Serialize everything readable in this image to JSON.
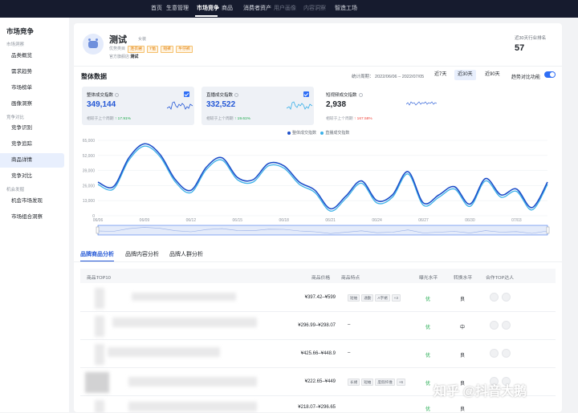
{
  "topnav": {
    "items": [
      "首页",
      "生意管理",
      "市场竞争",
      "商品",
      "消费者资产",
      "用户画像",
      "内容洞察",
      "智造工场"
    ],
    "active_index": 2
  },
  "sidebar": {
    "title": "市场竞争",
    "groups": {
      "market": "市场洞察",
      "compete": "竞争对比",
      "opportunity": "机会发掘"
    },
    "items": {
      "category": "品类概览",
      "demand": "需求趋势",
      "ranking": "市场榜单",
      "portrait": "画像洞察",
      "identify": "竞争识别",
      "track": "竞争追踪",
      "detail": "商品详情",
      "compare": "竞争对比",
      "discover": "机会市场发现",
      "combo": "市场组合洞察"
    },
    "active": "商品详情"
  },
  "shop": {
    "name": "测试",
    "badge": "女装",
    "categories_label": "优势类目",
    "tags": [
      "连衣裙",
      "T恤",
      "短裤",
      "牛仔裤"
    ],
    "official_label": "官方旗舰店",
    "official_value": "测试"
  },
  "rank": {
    "label": "近30天行业排名",
    "value": "57"
  },
  "overview": {
    "title": "整体数据",
    "stat_period_label": "统计周期：",
    "stat_period": "2022/06/06 – 2022/07/05",
    "ranges": [
      "近7天",
      "近30天",
      "近90天"
    ],
    "active_range": "近30天",
    "trend_compare_label": "趋势对比功能",
    "trend_compare_on": true
  },
  "cards": [
    {
      "title": "整体成交指数",
      "value": "349,144",
      "compare_label": "相较于上个周期",
      "change": "↑ 17.91%",
      "direction": "up",
      "checked": true
    },
    {
      "title": "直播成交指数",
      "value": "332,522",
      "compare_label": "相较于上个周期",
      "change": "↑ 19.61%",
      "direction": "up",
      "checked": true
    },
    {
      "title": "短视频成交指数",
      "value": "2,938",
      "compare_label": "相较于上个周期",
      "change": "↑ 167.58%",
      "direction": "down",
      "checked": false
    }
  ],
  "colors": {
    "accent": "#2357d6",
    "series_overall": "#1e4fc9",
    "series_live": "#3ab0e8",
    "up": "#1ba84a",
    "down": "#f0443b"
  },
  "chart_data": {
    "type": "line",
    "x": [
      "06/06",
      "06/07",
      "06/08",
      "06/09",
      "06/10",
      "06/11",
      "06/12",
      "06/13",
      "06/14",
      "06/15",
      "06/16",
      "06/17",
      "06/18",
      "06/19",
      "06/20",
      "06/21",
      "06/22",
      "06/23",
      "06/24",
      "06/25",
      "06/26",
      "06/27",
      "06/28",
      "06/29",
      "06/30",
      "07/01",
      "07/02",
      "07/03",
      "07/04",
      "07/05"
    ],
    "tick_labels": [
      "06/06",
      "06/09",
      "06/12",
      "06/15",
      "06/18",
      "06/21",
      "06/24",
      "06/27",
      "06/30",
      "07/03"
    ],
    "series": [
      {
        "name": "整体成交指数",
        "values": [
          29000,
          25000,
          50000,
          62000,
          53000,
          31000,
          22000,
          42000,
          50000,
          33000,
          31000,
          45000,
          43000,
          29000,
          22000,
          6000,
          17000,
          30000,
          13000,
          18000,
          38000,
          11000,
          18000,
          25000,
          10000,
          32000,
          18000,
          23000,
          7000,
          29000
        ]
      },
      {
        "name": "直播成交指数",
        "values": [
          27000,
          23000,
          48000,
          60000,
          51000,
          29000,
          20000,
          40000,
          48000,
          31000,
          29000,
          43000,
          41000,
          27000,
          20000,
          4000,
          15000,
          28000,
          11000,
          16000,
          36000,
          9000,
          16000,
          23000,
          8000,
          30000,
          16000,
          21000,
          5000,
          27000
        ]
      }
    ],
    "ylim": [
      0,
      65000
    ],
    "yticks": [
      "65,000",
      "52,000",
      "39,000",
      "26,000",
      "13,000",
      "0"
    ],
    "legend": "top-center",
    "grid": true
  },
  "tabs": [
    "品牌商品分析",
    "品牌内容分析",
    "品牌人群分析"
  ],
  "active_tab": "品牌商品分析",
  "table": {
    "headers": [
      "商品TOP10",
      "商品价格",
      "商品特点",
      "曝光水平",
      "转换水平",
      "合作TOP达人"
    ],
    "rows": [
      {
        "price": "¥397.42–¥599",
        "features": [
          "短袖",
          "通勤",
          "A字裙",
          "+3"
        ],
        "exposure": "优",
        "conversion": "良"
      },
      {
        "price": "¥296.99–¥298.07",
        "features": [
          "–"
        ],
        "exposure": "优",
        "conversion": "中"
      },
      {
        "price": "¥425.66–¥448.9",
        "features": [
          "–"
        ],
        "exposure": "优",
        "conversion": "良"
      },
      {
        "price": "¥222.65–¥449",
        "features": [
          "长裙",
          "短袖",
          "度假纤维",
          "+6"
        ],
        "exposure": "优",
        "conversion": "良"
      },
      {
        "price": "¥218.07–¥296.65",
        "features": [],
        "exposure": "优",
        "conversion": "良"
      }
    ]
  },
  "watermark": "知乎 @抖音大鹅"
}
